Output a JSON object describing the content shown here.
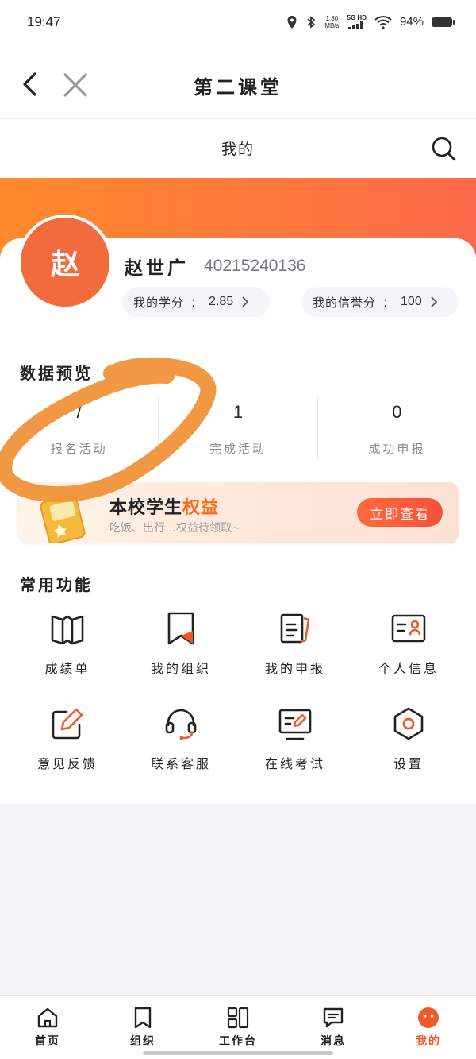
{
  "status_bar": {
    "time": "19:47",
    "net_speed": "1.80",
    "net_unit": "MB/s",
    "signal": "5G HD",
    "battery": "94%"
  },
  "nav": {
    "title": "第二课堂"
  },
  "sub_header": {
    "title": "我的"
  },
  "profile": {
    "avatar_text": "赵",
    "name": "赵世广",
    "student_id": "40215240136",
    "credits": {
      "label": "我的学分",
      "sep": "：",
      "value": "2.85"
    },
    "credit_score": {
      "label": "我的信誉分",
      "sep": "：",
      "value": "100"
    }
  },
  "data_preview": {
    "title": "数据预览",
    "stats": [
      {
        "value": "/",
        "label": "报名活动"
      },
      {
        "value": "1",
        "label": "完成活动"
      },
      {
        "value": "0",
        "label": "成功申报"
      }
    ]
  },
  "promo": {
    "title_main": "本校学生",
    "title_highlight": "权益",
    "subtitle": "吃饭、出行…权益待领取~",
    "button": "立即查看"
  },
  "functions": {
    "title": "常用功能",
    "items": [
      {
        "label": "成绩单",
        "icon": "book-icon"
      },
      {
        "label": "我的组织",
        "icon": "bookmark-icon"
      },
      {
        "label": "我的申报",
        "icon": "document-icon"
      },
      {
        "label": "个人信息",
        "icon": "id-card-icon"
      },
      {
        "label": "意见反馈",
        "icon": "edit-icon"
      },
      {
        "label": "联系客服",
        "icon": "headset-icon"
      },
      {
        "label": "在线考试",
        "icon": "monitor-icon"
      },
      {
        "label": "设置",
        "icon": "settings-icon"
      }
    ]
  },
  "tabs": [
    {
      "label": "首页",
      "icon": "home-icon"
    },
    {
      "label": "组织",
      "icon": "bookmark-icon"
    },
    {
      "label": "工作台",
      "icon": "grid-icon"
    },
    {
      "label": "消息",
      "icon": "message-icon"
    },
    {
      "label": "我的",
      "icon": "smiley-icon",
      "active": true
    }
  ],
  "colors": {
    "accent": "#f05a28",
    "banner_start": "#ff8a2c",
    "banner_end": "#ff6a4a",
    "annotation": "#f0923a"
  }
}
